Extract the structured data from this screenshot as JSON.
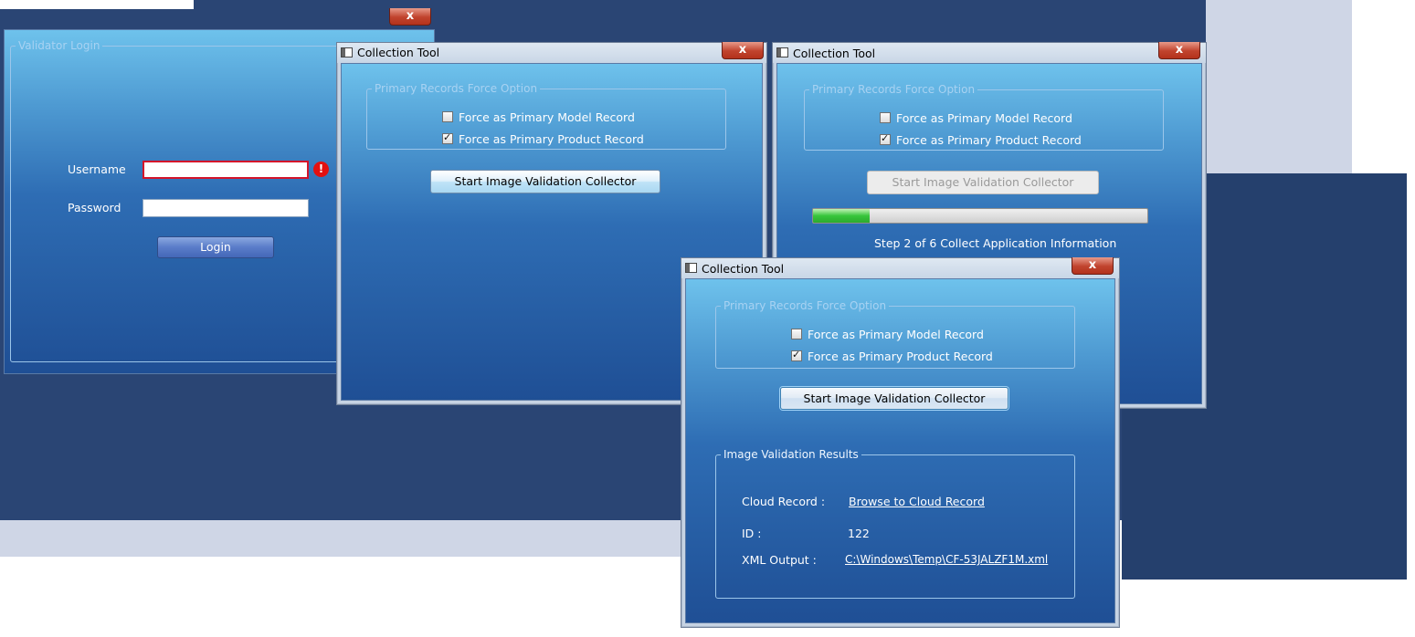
{
  "login_window": {
    "group_label": "Validator Login",
    "username_label": "Username",
    "username_value": "",
    "username_error_symbol": "!",
    "password_label": "Password",
    "password_value": "",
    "login_button": "Login",
    "close_symbol": "x"
  },
  "collection_window_1": {
    "title": "Collection Tool",
    "close_symbol": "x",
    "group_label": "Primary Records Force Option",
    "checkbox_model": {
      "label": "Force as Primary Model Record",
      "checked": false
    },
    "checkbox_product": {
      "label": "Force as Primary Product Record",
      "checked": true
    },
    "start_button": "Start Image Validation Collector"
  },
  "collection_window_2": {
    "title": "Collection Tool",
    "close_symbol": "x",
    "group_label": "Primary Records Force Option",
    "checkbox_model": {
      "label": "Force as Primary Model Record",
      "checked": false
    },
    "checkbox_product": {
      "label": "Force as Primary Product Record",
      "checked": true
    },
    "start_button": "Start Image Validation Collector",
    "start_button_enabled": false,
    "progress_fraction": 0.17,
    "status_text": "Step 2  of  6 Collect Application Information"
  },
  "collection_window_3": {
    "title": "Collection Tool",
    "close_symbol": "x",
    "group_label": "Primary Records Force Option",
    "checkbox_model": {
      "label": "Force as Primary Model Record",
      "checked": false
    },
    "checkbox_product": {
      "label": "Force as Primary Product Record",
      "checked": true
    },
    "start_button": "Start Image Validation Collector",
    "results": {
      "group_label": "Image Validation Results",
      "cloud_record_label": "Cloud Record :",
      "cloud_record_link": "Browse to Cloud Record",
      "id_label": "ID :",
      "id_value": "122",
      "xml_label": "XML Output  :",
      "xml_value": "C:\\Windows\\Temp\\CF-53JALZF1M.xml"
    }
  },
  "colors": {
    "desktop": "#2a4574",
    "client_top": "#6ec2ec",
    "client_bottom": "#1f4f95",
    "progress_fill": "#37c53b",
    "error": "#e31010"
  }
}
